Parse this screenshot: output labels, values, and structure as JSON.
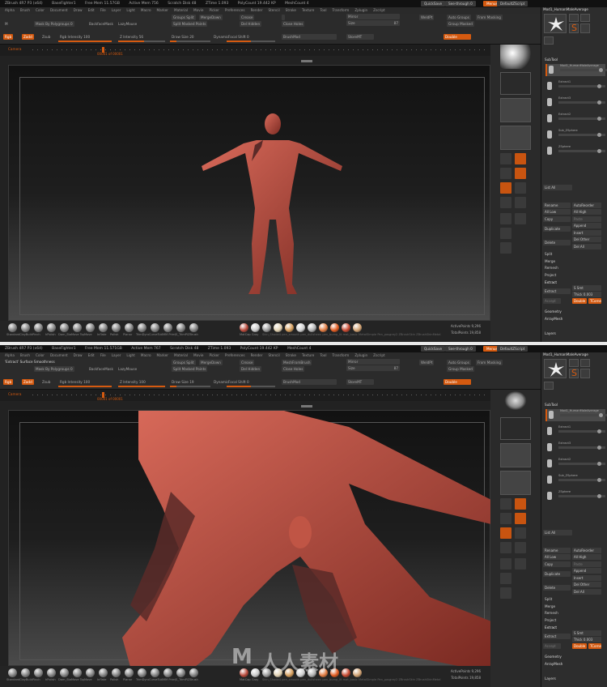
{
  "panels": [
    {
      "title_bar": [
        "ZBrush 4R7 P3 (x64)",
        "BaseFighter1",
        "Free Mem 11.57GB",
        "Active Mem 756",
        "Scratch Disk 48",
        "ZTime 1.093",
        "PolyCount 19.442 KP",
        "MeshCount 4"
      ],
      "menu": [
        "Alpha",
        "Brush",
        "Color",
        "Document",
        "Draw",
        "Edit",
        "File",
        "Layer",
        "Light",
        "Macro",
        "Marker",
        "Material",
        "Movie",
        "Picker",
        "Preferences",
        "Render",
        "Stencil",
        "Stroke",
        "Texture",
        "Tool",
        "Transform",
        "Zplugin",
        "Zscript"
      ],
      "quick_buttons": [
        "QuickSave",
        "See-through 0",
        "Menus",
        "DefaultZScript"
      ],
      "info_text": "",
      "toolbar": {
        "m_label": "M",
        "mask_by_polygroups": "Mask By Polygroups 0",
        "backface_mask": "BackfaceMask",
        "lazy_mouse": "LazyMouse",
        "groups_split": "Groups Split",
        "merge_down": "MergeDown",
        "split_masked_points": "Split Masked Points",
        "crease": "Crease",
        "mesh_from_brush": "",
        "del_hidden": "Del Hidden",
        "close_holes": "Close Holes",
        "mirror": "Mirror",
        "size": "Size",
        "size_value": "87",
        "weld_pt": "WeldPt",
        "auto_groups": "Auto Groups",
        "from_masking": "From Masking",
        "group_masked": "Group Masked",
        "rgb": "Rgb",
        "zadd": "Zadd",
        "zsub": "Zsub",
        "rgb_intensity": "Rgb Intensity 100",
        "z_intensity": "Z Intensity 56",
        "draw_size": "Draw Size 20",
        "dynamic": "Dynamic",
        "focal_shift": "Focal Shift 0",
        "brushmod": "BrushMod",
        "storemt": "StoreMT",
        "double": "Double"
      },
      "timeline": {
        "label": "Camera",
        "frame_label": "00001 of 00001"
      },
      "brushes": [
        "Standard",
        "ClayBuildup",
        "Pinch",
        "hPolish",
        "Dam_Standard",
        "Move Topological",
        "Move",
        "Inflate",
        "Polish",
        "Planar",
        "TrimDynamic",
        "CurveTubeSnap",
        "IMM Primitives",
        "JS_TrimPlanes",
        "ZBrush"
      ],
      "material_label": "MatCap Gray",
      "material_names": "Skin_Shade4 pen_smooth pen_dullsheen pen_bump_lit mat_basic MetalSimple Pen_posgrey2 ZBrushSkin ZBrushSkinMetal",
      "active_points": "ActivePoints 9,296",
      "total_points": "TotalPoints 19,858",
      "right_strip": [
        "Persp",
        "Floor",
        "Local",
        "L.Sym",
        "Frame",
        "Move",
        "Scale",
        "Rotate",
        "Line Fill",
        "PolyF",
        "Transp",
        "Ghost",
        "Solo",
        "Xpose"
      ],
      "tool_tray": {
        "header": "Mod1_HumanMaleAverage",
        "tools": [
          "Mod1_HumanMaleAverage",
          "SimpleBrush",
          "PolyMesh3D",
          "Cylinder3D",
          "Cylinder3D"
        ],
        "subtool_title": "SubTool",
        "subtools": [
          "Mod1_HumanMaleAverage",
          "Extract1",
          "Extract3",
          "Extract2",
          "Sub_ZSphere",
          "ZSphere"
        ],
        "list_all": "List All",
        "rename": "Rename",
        "auto_reorder": "AutoReorder",
        "all_low": "All Low",
        "all_high": "All High",
        "copy": "Copy",
        "paste": "Paste",
        "duplicate": "Duplicate",
        "append": "Append",
        "insert": "Insert",
        "delete": "Delete",
        "del_other": "Del Other",
        "del_all": "Del All",
        "split": "Split",
        "merge": "Merge",
        "remesh": "Remesh",
        "project": "Project",
        "extract_section": "Extract",
        "extract_btn": "Extract",
        "s_smt": "S Smt",
        "thick": "Thick",
        "thick_value": "0.003",
        "accept": "Accept",
        "double": "Double",
        "tcorne": "TCorne",
        "geometry": "Geometry",
        "array_mesh": "ArrayMesh",
        "layers": "Layers"
      }
    },
    {
      "title_bar": [
        "ZBrush 4R7 P3 (x64)",
        "BaseFighter1",
        "Free Mem 11.571GB",
        "Active Mem 767",
        "Scratch Disk 48",
        "ZTime 1.093",
        "PolyCount 19.442 KP",
        "MeshCount 4"
      ],
      "menu": [
        "Alpha",
        "Brush",
        "Color",
        "Document",
        "Draw",
        "Edit",
        "File",
        "Layer",
        "Light",
        "Macro",
        "Marker",
        "Material",
        "Movie",
        "Picker",
        "Preferences",
        "Render",
        "Stencil",
        "Stroke",
        "Texture",
        "Tool",
        "Transform",
        "Zplugin",
        "Zscript"
      ],
      "quick_buttons": [
        "QuickSave",
        "See-through 0",
        "Menus",
        "DefaultZScript"
      ],
      "info_text": "'Extract' Surface Smoothness",
      "toolbar": {
        "m_label": "",
        "mask_by_polygroups": "Mask By Polygroups 0",
        "backface_mask": "BackfaceMask",
        "lazy_mouse": "LazyMouse",
        "groups_split": "Groups Split",
        "merge_down": "MergeDown",
        "split_masked_points": "Split Masked Points",
        "crease": "Crease",
        "mesh_from_brush": "MeshFromBrush",
        "del_hidden": "Del Hidden",
        "close_holes": "Close Holes",
        "mirror": "Mirror",
        "size": "Size",
        "size_value": "87",
        "weld_pt": "WeldPt",
        "auto_groups": "Auto Groups",
        "from_masking": "From Masking",
        "group_masked": "Group Masked",
        "rgb": "Rgb",
        "zadd": "Zadd",
        "zsub": "Zsub",
        "rgb_intensity": "Rgb Intensity 100",
        "z_intensity": "Z Intensity 100",
        "draw_size": "Draw Size 19",
        "dynamic": "Dynamic",
        "focal_shift": "Focal Shift 0",
        "brushmod": "BrushMod",
        "storemt": "StoreMT",
        "double": "Double"
      },
      "timeline": {
        "label": "Camera",
        "frame_label": "00001 of 00001"
      },
      "brushes": [
        "Standard",
        "ClayBuildup",
        "Pinch",
        "hPolish",
        "Dam_Standard",
        "Move Topological",
        "Move",
        "Inflate",
        "Polish",
        "Planar",
        "TrimDynamic",
        "CurveTubeSnap",
        "IMM Primitives",
        "JS_TrimPlanes",
        "ZBrush"
      ],
      "material_label": "MatCap Gray",
      "material_names": "Skin_Shade4 pen_smooth pen_dullsheen pen_bump_lit mat_basic MetalSimple Pen_posgrey2 ZBrushSkin ZBrushSkinMetal",
      "active_points": "ActivePoints 9,296",
      "total_points": "TotalPoints 19,858",
      "right_strip": [
        "Persp",
        "Floor",
        "Local",
        "L.Sym",
        "Frame",
        "Move",
        "Scale",
        "Rotate",
        "Line Fill",
        "PolyF",
        "Transp",
        "Ghost",
        "Solo",
        "Xpose"
      ],
      "tool_tray": {
        "header": "Mod1_HumanMaleAverage",
        "tools": [
          "Mod1_HumanMaleAverage",
          "SimpleBrush",
          "PolyMesh3D",
          "Cylinder3D",
          "Cylinder3D"
        ],
        "subtool_title": "SubTool",
        "subtools": [
          "Mod1_HumanMaleAverage",
          "Extract1",
          "Extract3",
          "Extract2",
          "Sub_ZSphere",
          "ZSphere"
        ],
        "list_all": "List All",
        "rename": "Rename",
        "auto_reorder": "AutoReorder",
        "all_low": "All Low",
        "all_high": "All High",
        "copy": "Copy",
        "paste": "Paste",
        "duplicate": "Duplicate",
        "append": "Append",
        "insert": "Insert",
        "delete": "Delete",
        "del_other": "Del Other",
        "del_all": "Del All",
        "split": "Split",
        "merge": "Merge",
        "remesh": "Remesh",
        "project": "Project",
        "extract_section": "Extract",
        "extract_btn": "Extract",
        "s_smt": "S Smt",
        "thick": "Thick",
        "thick_value": "0.003",
        "accept": "Accept",
        "double": "Double",
        "tcorne": "TCorne",
        "geometry": "Geometry",
        "array_mesh": "ArrayMesh",
        "layers": "Layers"
      }
    }
  ],
  "watermark": {
    "brand": "人人素材",
    "logo": "M"
  },
  "colors": {
    "accent": "#d55a10",
    "skin": "#b8483a",
    "background": "#222222"
  }
}
